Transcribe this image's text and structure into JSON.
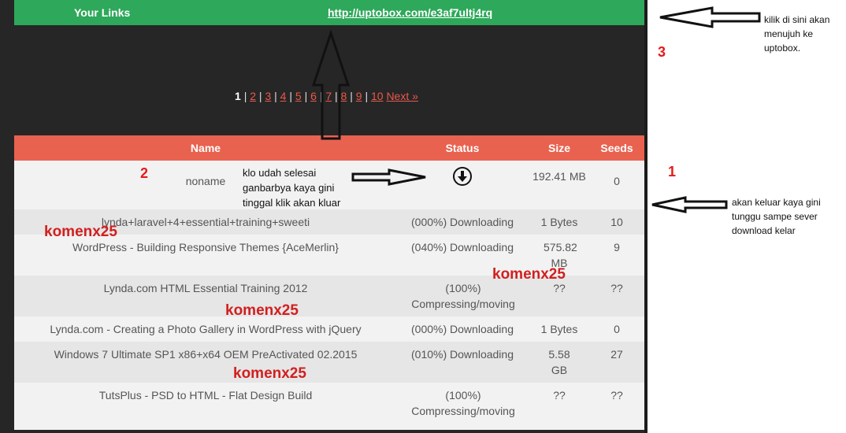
{
  "links_bar": {
    "label": "Your Links",
    "url": "http://uptobox.com/e3af7ultj4rq"
  },
  "pager": {
    "current": "1",
    "pages": [
      "2",
      "3",
      "4",
      "5",
      "6",
      "7",
      "8",
      "9",
      "10"
    ],
    "next": "Next »"
  },
  "table": {
    "headers": {
      "name": "Name",
      "status": "Status",
      "size": "Size",
      "seeds": "Seeds"
    },
    "rows": [
      {
        "name": "noname",
        "status": "",
        "size": "192.41 MB",
        "seeds": "0"
      },
      {
        "name": "lynda+laravel+4+essential+training+sweeti",
        "status": "(000%) Downloading",
        "size": "1 Bytes",
        "seeds": "10"
      },
      {
        "name": "WordPress - Building Responsive Themes {AceMerlin}",
        "status": "(040%) Downloading",
        "size": "575.82 MB",
        "seeds": "9"
      },
      {
        "name": "Lynda.com HTML Essential Training 2012",
        "status": "(100%) Compressing/moving",
        "size": "??",
        "seeds": "??"
      },
      {
        "name": "Lynda.com - Creating a Photo Gallery in WordPress with jQuery",
        "status": "(000%) Downloading",
        "size": "1 Bytes",
        "seeds": "0"
      },
      {
        "name": "Windows 7 Ultimate SP1 x86+x64 OEM PreActivated 02.2015",
        "status": "(010%) Downloading",
        "size": "5.58 GB",
        "seeds": "27"
      },
      {
        "name": "TutsPlus - PSD to HTML - Flat Design Build",
        "status": "(100%) Compressing/moving",
        "size": "??",
        "seeds": "??"
      }
    ]
  },
  "annotations": {
    "num_1": "1",
    "num_2": "2",
    "num_3": "3",
    "note_1": "akan keluar kaya gini tunggu sampe sever download kelar",
    "note_2": "klo udah selesai ganbarbya kaya gini tinggal klik akan kluar",
    "note_3": "kilik di sini akan menujuh ke uptobox.",
    "watermark": "komenx25"
  },
  "icons": {
    "status_download": "download-circle-icon"
  }
}
